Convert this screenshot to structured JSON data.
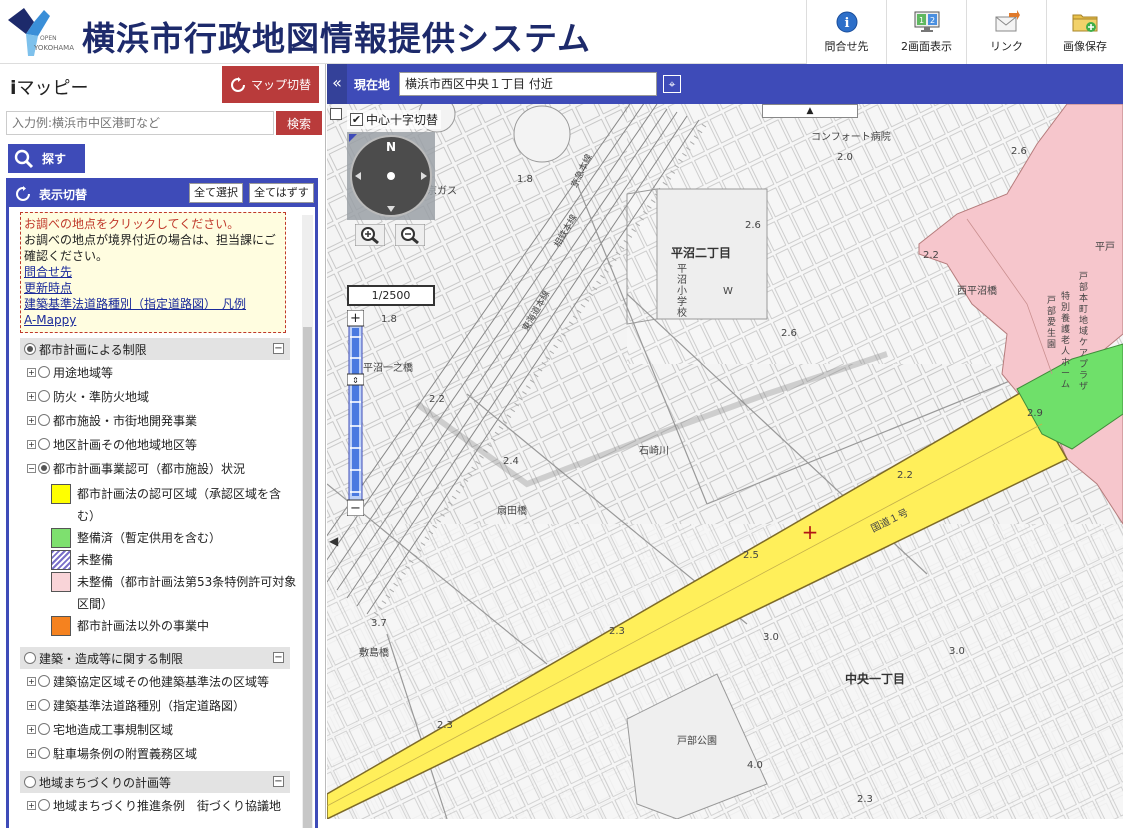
{
  "header": {
    "logo_text_top": "OPEN",
    "logo_text_bottom": "YOKOHAMA",
    "title": "横浜市行政地図情報提供システム",
    "buttons": [
      {
        "label": "問合せ先",
        "icon": "info-icon"
      },
      {
        "label": "2画面表示",
        "icon": "dual-screen-icon"
      },
      {
        "label": "リンク",
        "icon": "mail-link-icon"
      },
      {
        "label": "画像保存",
        "icon": "folder-save-icon"
      }
    ]
  },
  "sidebar": {
    "app_name_prefix": "i",
    "app_name": "マッピー",
    "map_switch_label": "マップ切替",
    "search_placeholder": "入力例:横浜市中区港町など",
    "search_button": "検索",
    "find_button": "探す",
    "toggle_title": "表示切替",
    "select_all": "全て選択",
    "deselect_all": "全てはずす",
    "notice": {
      "line1": "お調べの地点をクリックしてください。",
      "line2": "お調べの地点が境界付近の場合は、担当課にご確認ください。",
      "links": [
        "問合せ先",
        "更新時点",
        "建築基準法道路種別（指定道路図）　凡例",
        "A-Mappy"
      ]
    },
    "sections": [
      {
        "title": "都市計画による制限",
        "selected": true,
        "items": [
          {
            "label": "用途地域等",
            "selected": false,
            "expanded": false
          },
          {
            "label": "防火・準防火地域",
            "selected": false,
            "expanded": false
          },
          {
            "label": "都市施設・市街地開発事業",
            "selected": false,
            "expanded": false
          },
          {
            "label": "地区計画その他地域地区等",
            "selected": false,
            "expanded": false
          },
          {
            "label": "都市計画事業認可（都市施設）状況",
            "selected": true,
            "expanded": true
          }
        ],
        "legend": [
          {
            "label": "都市計画法の認可区域（承認区域を含む）",
            "color": "#ffff00"
          },
          {
            "label": "整備済（暫定供用を含む）",
            "color": "#7ee06f"
          },
          {
            "label": "未整備",
            "color": "hatched-purple"
          },
          {
            "label": "未整備（都市計画法第53条特例許可対象区間）",
            "color": "#f9d4d8"
          },
          {
            "label": "都市計画法以外の事業中",
            "color": "#f5821f"
          }
        ]
      },
      {
        "title": "建築・造成等に関する制限",
        "selected": false,
        "items": [
          {
            "label": "建築協定区域その他建築基準法の区域等",
            "selected": false
          },
          {
            "label": "建築基準法道路種別（指定道路図）",
            "selected": false
          },
          {
            "label": "宅地造成工事規制区域",
            "selected": false
          },
          {
            "label": "駐車場条例の附置義務区域",
            "selected": false
          }
        ]
      },
      {
        "title": "地域まちづくりの計画等",
        "selected": false,
        "items": [
          {
            "label": "地域まちづくり推進条例　街づくり協議地",
            "selected": false
          }
        ]
      }
    ]
  },
  "locbar": {
    "collapse": "«",
    "label": "現在地",
    "value": "横浜市西区中央１丁目 付近",
    "target_icon": "crosshair-icon"
  },
  "map": {
    "cross_toggle_label": "中心十字切替",
    "cross_toggle_checked": true,
    "compass_north": "N",
    "scale": "1/2500",
    "zoom_in": "+",
    "zoom_out": "−",
    "labels": {
      "district1": "平沼二丁目",
      "district2": "中央一丁目",
      "river": "石崎川",
      "bridge1": "西平沼橋",
      "bridge2": "平沼一之橋",
      "bridge3": "扇田橋",
      "bridge4": "敷島橋",
      "route": "国道１号",
      "hospital": "コンフォート病院",
      "gas": "東京ガス",
      "park": "戸部公園",
      "school": "平沼小学校",
      "rail1": "京急本線",
      "rail2": "相鉄本線",
      "rail3": "東海道本線",
      "facility": "戸部本町地域ケアプラザ",
      "facility2": "特別養護老人ホーム",
      "facility3": "戸部愛生園",
      "hira": "平戸",
      "w": "W",
      "elev": [
        "2.6",
        "1.8",
        "2.0",
        "2.6",
        "2.6",
        "2.2",
        "1.8",
        "2.2",
        "2.4",
        "2.9",
        "2.2",
        "2.5",
        "2.3",
        "3.0",
        "3.0",
        "3.7",
        "2.3",
        "4.0",
        "2.3"
      ]
    }
  },
  "colors": {
    "brand_blue": "#3e4bb8",
    "title_navy": "#1d2a6b",
    "accent_red": "#b93b3b",
    "road_yellow": "#ffef5a",
    "road_pink": "#f6c6cc",
    "green": "#6fe06a"
  }
}
